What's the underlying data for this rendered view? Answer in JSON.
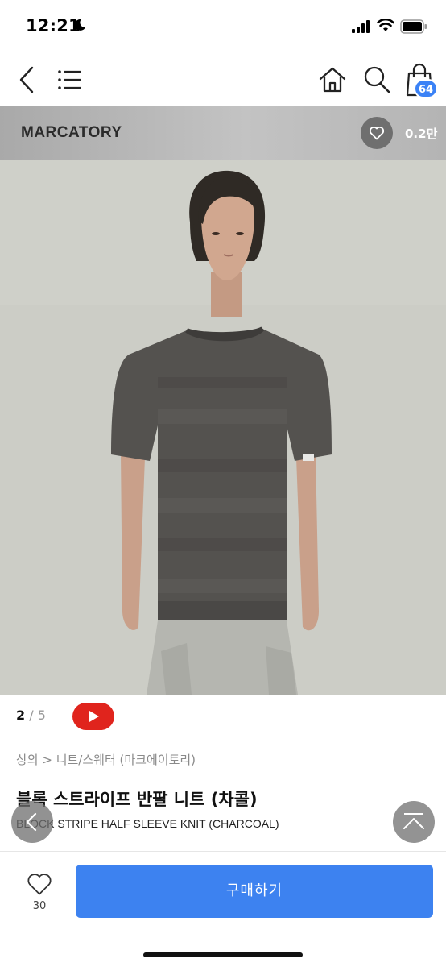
{
  "status": {
    "time": "12:21"
  },
  "nav": {
    "back_icon": "chevron-left-icon",
    "menu_icon": "menu-icon",
    "home_icon": "home-icon",
    "search_icon": "search-icon",
    "cart_icon": "shopping-bag-icon",
    "cart_count": "64"
  },
  "brand": {
    "name": "MARCATORY",
    "like_count": "0.2만"
  },
  "slider": {
    "current": "2",
    "separator": " / ",
    "total": "5"
  },
  "product": {
    "breadcrumb": "상의 > 니트/스웨터 (마크에이토리)",
    "title": "블록 스트라이프 반팔 니트 (차콜)",
    "subtitle": "BLOCK STRIPE HALF SLEEVE KNIT (CHARCOAL)"
  },
  "actions": {
    "wish_count": "30",
    "buy_label": "구매하기"
  },
  "colors": {
    "accent": "#3d82f0",
    "video_red": "#e0241d",
    "badge": "#3b82f6"
  }
}
